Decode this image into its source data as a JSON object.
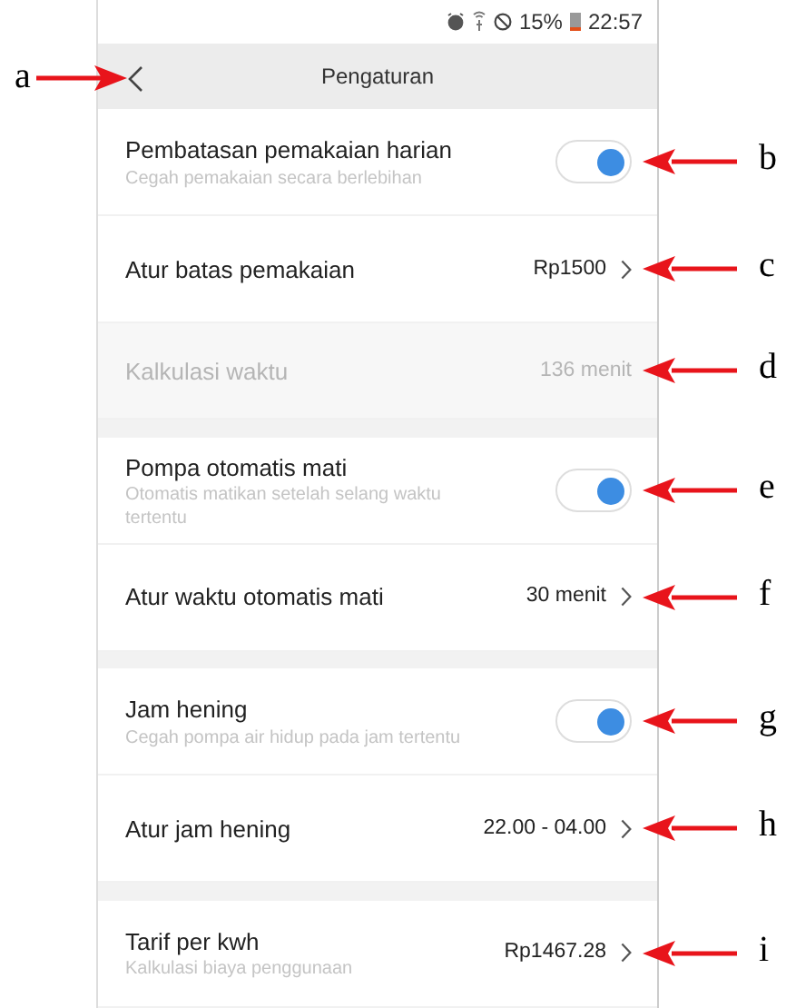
{
  "status_bar": {
    "battery": "15%",
    "time": "22:57"
  },
  "header": {
    "title": "Pengaturan",
    "annotation": "a"
  },
  "sections": [
    {
      "rows": [
        {
          "kind": "toggle",
          "title": "Pembatasan pemakaian harian",
          "subtitle": "Cegah pemakaian secara berlebihan",
          "on": true,
          "disabled": false,
          "annotation": "b"
        },
        {
          "kind": "link",
          "title": "Atur batas pemakaian",
          "value": "Rp1500",
          "disabled": false,
          "annotation": "c"
        },
        {
          "kind": "info",
          "title": "Kalkulasi waktu",
          "value": "136 menit",
          "disabled": true,
          "annotation": "d"
        }
      ]
    },
    {
      "rows": [
        {
          "kind": "toggle",
          "title": "Pompa otomatis mati",
          "subtitle": "Otomatis matikan setelah selang waktu tertentu",
          "on": true,
          "disabled": false,
          "annotation": "e"
        },
        {
          "kind": "link",
          "title": "Atur waktu otomatis mati",
          "value": "30 menit",
          "disabled": false,
          "annotation": "f"
        }
      ]
    },
    {
      "rows": [
        {
          "kind": "toggle",
          "title": "Jam hening",
          "subtitle": "Cegah pompa air hidup pada jam tertentu",
          "on": true,
          "disabled": false,
          "annotation": "g"
        },
        {
          "kind": "link",
          "title": "Atur jam hening",
          "value": "22.00 - 04.00",
          "disabled": false,
          "annotation": "h"
        }
      ]
    },
    {
      "rows": [
        {
          "kind": "link",
          "title": "Tarif per kwh",
          "subtitle": "Kalkulasi biaya penggunaan",
          "value": "Rp1467.28",
          "disabled": false,
          "annotation": "i"
        }
      ]
    }
  ]
}
